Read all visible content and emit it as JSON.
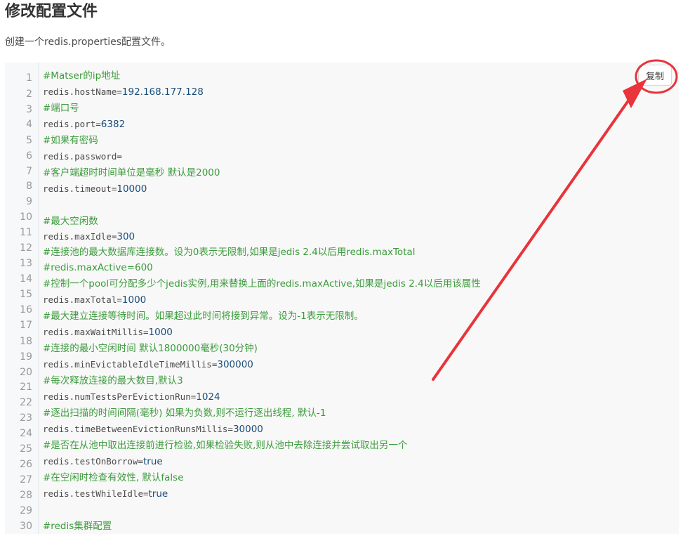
{
  "page": {
    "title": "修改配置文件",
    "intro": "创建一个redis.properties配置文件。",
    "copy_label": "复制"
  },
  "code": {
    "lines": [
      {
        "n": "1",
        "type": "comment",
        "text": "#Matser的ip地址"
      },
      {
        "n": "2",
        "type": "code",
        "key": "redis.hostName=",
        "value": "192.168.177.128"
      },
      {
        "n": "3",
        "type": "comment",
        "text": "#端口号"
      },
      {
        "n": "4",
        "type": "code",
        "key": "redis.port=",
        "value": "6382"
      },
      {
        "n": "5",
        "type": "comment",
        "text": "#如果有密码"
      },
      {
        "n": "6",
        "type": "code",
        "key": "redis.password=",
        "value": ""
      },
      {
        "n": "7",
        "type": "comment",
        "text": "#客户端超时时间单位是毫秒 默认是2000"
      },
      {
        "n": "8",
        "type": "code",
        "key": "redis.timeout=",
        "value": "10000"
      },
      {
        "n": "9",
        "type": "blank"
      },
      {
        "n": "10",
        "type": "comment",
        "text": "#最大空闲数"
      },
      {
        "n": "11",
        "type": "code",
        "key": "redis.maxIdle=",
        "value": "300"
      },
      {
        "n": "12",
        "type": "comment",
        "text": "#连接池的最大数据库连接数。设为0表示无限制,如果是jedis 2.4以后用redis.maxTotal"
      },
      {
        "n": "13",
        "type": "comment",
        "text": "#redis.maxActive=600"
      },
      {
        "n": "14",
        "type": "comment",
        "text": "#控制一个pool可分配多少个jedis实例,用来替换上面的redis.maxActive,如果是jedis 2.4以后用该属性"
      },
      {
        "n": "15",
        "type": "code",
        "key": "redis.maxTotal=",
        "value": "1000"
      },
      {
        "n": "16",
        "type": "comment",
        "text": "#最大建立连接等待时间。如果超过此时间将接到异常。设为-1表示无限制。"
      },
      {
        "n": "17",
        "type": "code",
        "key": "redis.maxWaitMillis=",
        "value": "1000"
      },
      {
        "n": "18",
        "type": "comment",
        "text": "#连接的最小空闲时间 默认1800000毫秒(30分钟)"
      },
      {
        "n": "19",
        "type": "code",
        "key": "redis.minEvictableIdleTimeMillis=",
        "value": "300000"
      },
      {
        "n": "20",
        "type": "comment",
        "text": "#每次释放连接的最大数目,默认3"
      },
      {
        "n": "21",
        "type": "code",
        "key": "redis.numTestsPerEvictionRun=",
        "value": "1024"
      },
      {
        "n": "22",
        "type": "comment",
        "text": "#逐出扫描的时间间隔(毫秒) 如果为负数,则不运行逐出线程, 默认-1"
      },
      {
        "n": "23",
        "type": "code",
        "key": "redis.timeBetweenEvictionRunsMillis=",
        "value": "30000"
      },
      {
        "n": "24",
        "type": "comment",
        "text": "#是否在从池中取出连接前进行检验,如果检验失败,则从池中去除连接并尝试取出另一个"
      },
      {
        "n": "25",
        "type": "code",
        "key": "redis.testOnBorrow=",
        "value": "true"
      },
      {
        "n": "26",
        "type": "comment",
        "text": "#在空闲时检查有效性, 默认false"
      },
      {
        "n": "27",
        "type": "code",
        "key": "redis.testWhileIdle=",
        "value": "true"
      },
      {
        "n": "28",
        "type": "blank"
      },
      {
        "n": "29",
        "type": "comment",
        "text": "#redis集群配置"
      },
      {
        "n": "30",
        "type": "blank"
      }
    ]
  },
  "colors": {
    "comment": "#3c9b3c",
    "annotation": "#e8343a"
  }
}
